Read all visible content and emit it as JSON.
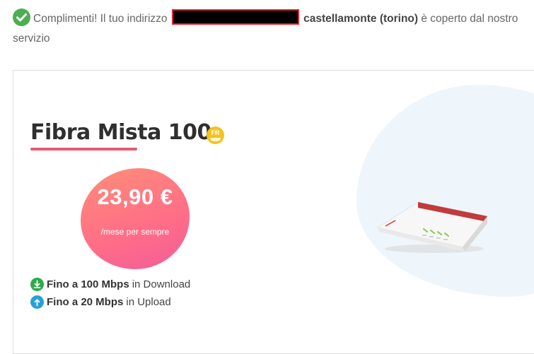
{
  "notice": {
    "prefix": "Complimenti! Il tuo indirizzo",
    "location": "castellamonte (torino)",
    "suffix": "è coperto dal nostro servizio"
  },
  "offer": {
    "title": "Fibra Mista 100",
    "badge": "FR",
    "price": "23,90 €",
    "period": "/mese per sempre",
    "features": [
      {
        "bold": "Fino a 100 Mbps",
        "text": "in Download",
        "icon": "download-icon",
        "color": "#2eaa4a"
      },
      {
        "bold": "Fino a 20 Mbps",
        "text": "in Upload",
        "icon": "upload-icon",
        "color": "#27a0d8"
      }
    ]
  },
  "colors": {
    "check": "#4caf50",
    "accent": "#e55a72",
    "badge": "#f6c21b"
  }
}
